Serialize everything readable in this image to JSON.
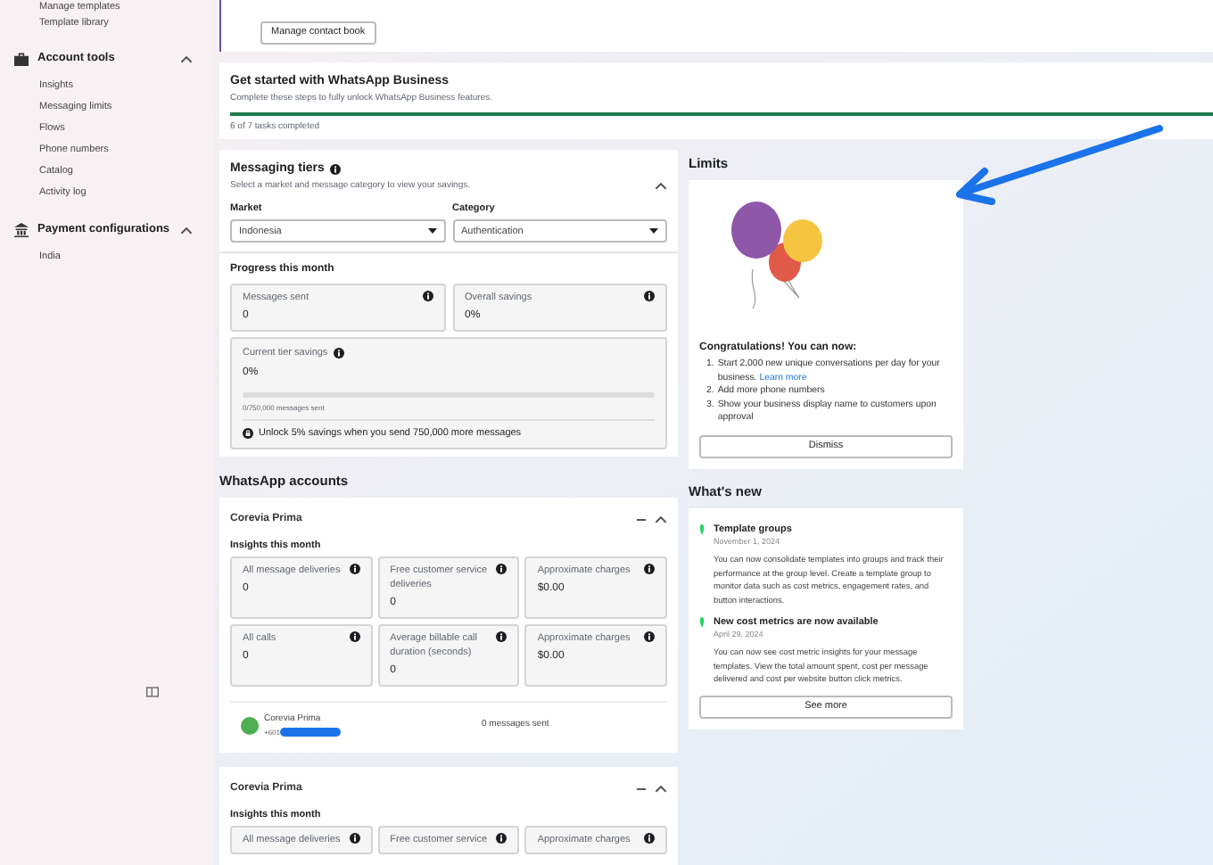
{
  "sidebar": {
    "top_items": [
      "Manage templates",
      "Template library"
    ],
    "sections": [
      {
        "title": "Account tools",
        "expanded": true,
        "items": [
          "Insights",
          "Messaging limits",
          "Flows",
          "Phone numbers",
          "Catalog",
          "Activity log"
        ]
      },
      {
        "title": "Payment configurations",
        "expanded": true,
        "items": [
          "India"
        ]
      }
    ]
  },
  "contact_card": {
    "button": "Manage contact book"
  },
  "get_started": {
    "title": "Get started with WhatsApp Business",
    "subtitle": "Complete these steps to fully unlock WhatsApp Business features.",
    "level": 1,
    "status": "6 of 7 tasks completed"
  },
  "messaging_tiers": {
    "title": "Messaging tiers",
    "subtitle": "Select a market and message category to view your savings.",
    "expanded": true,
    "fields": [
      {
        "label": "Market",
        "value": "Indonesia"
      },
      {
        "label": "Category",
        "value": "Authentication"
      }
    ],
    "progress_title": "Progress this month",
    "stats": [
      {
        "label": "Messages sent",
        "value": "0"
      },
      {
        "label": "Overall savings",
        "value": "0%"
      }
    ],
    "tier": {
      "label": "Current tier savings",
      "value": "0%",
      "level": 0,
      "caption": "0/750,000 messages sent",
      "unlock": "Unlock 5% savings when you send 750,000 more messages"
    }
  },
  "accounts": {
    "heading": "WhatsApp accounts",
    "cards": [
      {
        "name": "Corevia Prima",
        "insights_title": "Insights this month",
        "stats": [
          {
            "label": "All message deliveries",
            "value": "0"
          },
          {
            "label": "Free customer service deliveries",
            "value": "0"
          },
          {
            "label": "Approximate charges",
            "value": "$0.00"
          },
          {
            "label": "All calls",
            "value": "0"
          },
          {
            "label": "Average billable call duration (seconds)",
            "value": "0"
          },
          {
            "label": "Approximate charges",
            "value": "$0.00"
          }
        ],
        "phone": {
          "name": "Corevia Prima",
          "number": "+601",
          "redacted": true,
          "sent": "0 messages sent"
        }
      },
      {
        "name": "Corevia Prima",
        "insights_title": "Insights this month",
        "stats": [
          {
            "label": "All message deliveries"
          },
          {
            "label": "Free customer service"
          },
          {
            "label": "Approximate charges"
          }
        ]
      }
    ]
  },
  "limits": {
    "heading": "Limits",
    "title": "Congratulations! You can now:",
    "items": [
      {
        "number": "1.",
        "text": "Start 2,000 new unique conversations per day for your business.",
        "link": "Learn more"
      },
      {
        "number": "2.",
        "text": "Add more phone numbers"
      },
      {
        "number": "3.",
        "text": "Show your business display name to customers upon approval"
      }
    ],
    "button": "Dismiss"
  },
  "whats_new": {
    "heading": "What's new",
    "items": [
      {
        "title": "Template groups",
        "date": "November 1, 2024",
        "body": "You can now consolidate templates into groups and track their performance at the group level. Create a template group to monitor data such as cost metrics, engagement rates, and button interactions."
      },
      {
        "title": "New cost metrics are now available",
        "date": "April 29, 2024",
        "body": "You can now see cost metric insights for your message templates. View the total amount spent, cost per message delivered and cost per website button click metrics."
      }
    ],
    "button": "See more"
  }
}
